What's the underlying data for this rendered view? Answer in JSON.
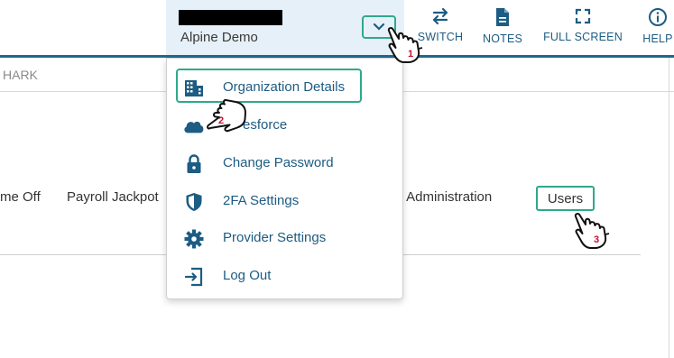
{
  "header": {
    "account_name": "Alpine Demo",
    "nav": [
      {
        "label": "SWITCH",
        "icon": "switch-arrows-icon"
      },
      {
        "label": "NOTES",
        "icon": "notes-icon"
      },
      {
        "label": "FULL SCREEN",
        "icon": "fullscreen-icon"
      },
      {
        "label": "HELP",
        "icon": "help-icon"
      }
    ]
  },
  "subbar": {
    "text": "HARK"
  },
  "menu_row": {
    "item1": "me Off",
    "item2": "Payroll Jackpot",
    "item3": "tal Administration",
    "users": "Users"
  },
  "dropdown": {
    "items": [
      {
        "label": "Organization Details",
        "icon": "building-icon"
      },
      {
        "label": "esforce",
        "icon": "cloud-icon"
      },
      {
        "label": "Change Password",
        "icon": "lock-icon"
      },
      {
        "label": "2FA Settings",
        "icon": "shield-icon"
      },
      {
        "label": "Provider Settings",
        "icon": "gear-icon"
      },
      {
        "label": "Log Out",
        "icon": "logout-icon"
      }
    ]
  },
  "annotations": {
    "step1": "1",
    "step2": "2",
    "step3": "3"
  },
  "colors": {
    "accent": "#1d5c83",
    "highlight": "#2ea98c",
    "step_number": "#c8102e"
  }
}
